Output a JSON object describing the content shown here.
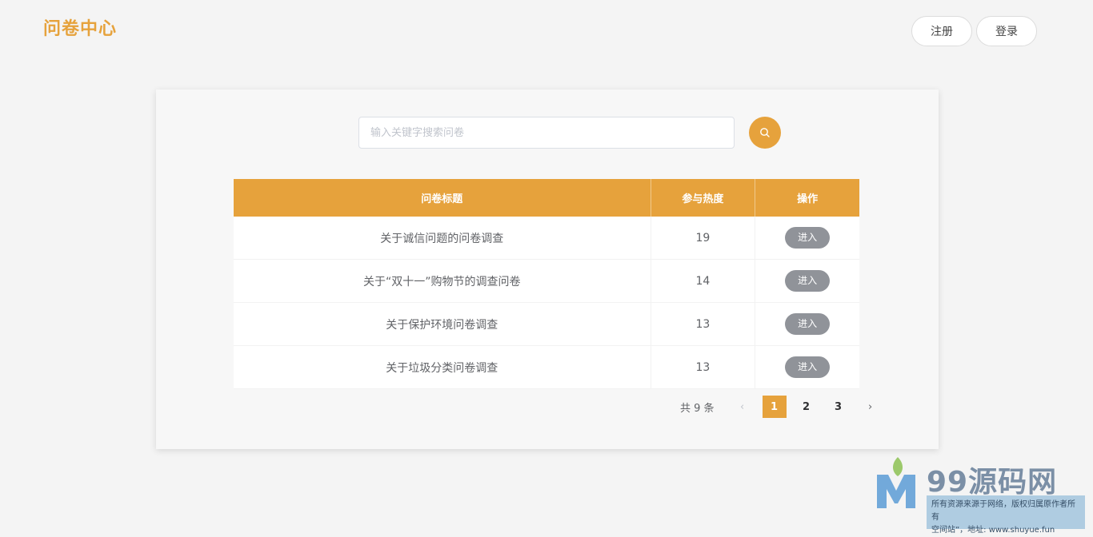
{
  "header": {
    "logo": "问卷中心",
    "register_label": "注册",
    "login_label": "登录"
  },
  "search": {
    "placeholder": "输入关键字搜索问卷",
    "value": ""
  },
  "table": {
    "headers": [
      "问卷标题",
      "参与热度",
      "操作"
    ],
    "rows": [
      {
        "title": "关于诚信问题的问卷调查",
        "heat": "19",
        "action": "进入"
      },
      {
        "title": "关于“双十一”购物节的调查问卷",
        "heat": "14",
        "action": "进入"
      },
      {
        "title": "关于保护环境问卷调查",
        "heat": "13",
        "action": "进入"
      },
      {
        "title": "关于垃圾分类问卷调查",
        "heat": "13",
        "action": "进入"
      }
    ]
  },
  "pagination": {
    "total": "共 9 条",
    "prev": "‹",
    "pages": [
      "1",
      "2",
      "3"
    ],
    "current": "1",
    "next": "›"
  },
  "watermark": {
    "brand": "99源码网",
    "notice_line1": "所有资源来源于网络，版权归属原作者所有",
    "notice_line2": "空间站”，地址: www.shuyue.fun"
  },
  "colors": {
    "accent": "#e6a23c",
    "button_gray": "#909399",
    "background": "#f4f4f4"
  }
}
